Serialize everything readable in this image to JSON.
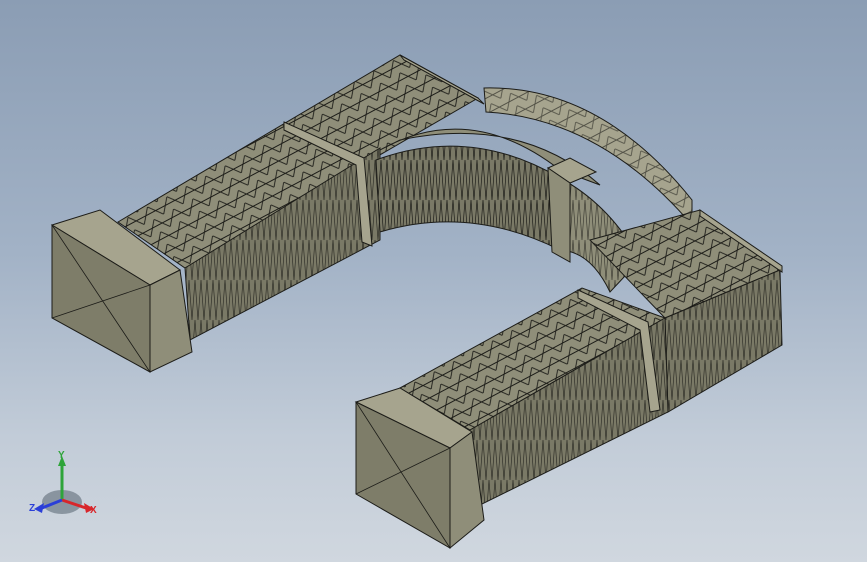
{
  "scene": {
    "model": "u-shaped-arched-bridge-mesh"
  },
  "colors": {
    "background_top": "#8b9db4",
    "background_bottom": "#d0d7df",
    "model_face_dark": "#7a7966",
    "model_face_mid": "#8f8e79",
    "model_face_light": "#a6a48e",
    "mesh_edge": "#1c1c18",
    "axis_x": "#d8262b",
    "axis_y": "#2ea43a",
    "axis_z": "#2b3fd8"
  },
  "triad": {
    "x_label": "X",
    "y_label": "Y",
    "z_label": "Z"
  }
}
